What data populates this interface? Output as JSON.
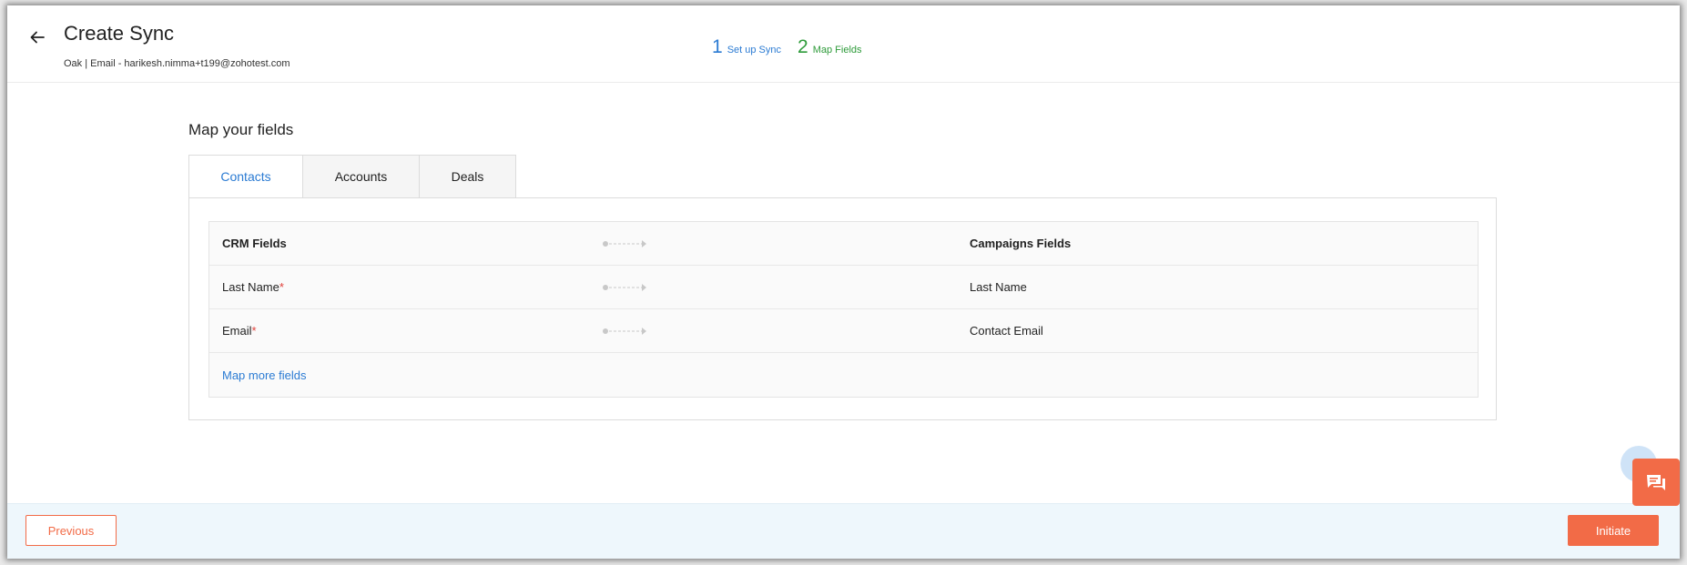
{
  "header": {
    "title": "Create Sync",
    "subtitle": "Oak | Email - harikesh.nimma+t199@zohotest.com",
    "steps": [
      {
        "number": "1",
        "label": "Set up Sync"
      },
      {
        "number": "2",
        "label": "Map Fields"
      }
    ]
  },
  "main": {
    "section_title": "Map your fields",
    "tabs": [
      {
        "label": "Contacts",
        "active": true
      },
      {
        "label": "Accounts",
        "active": false
      },
      {
        "label": "Deals",
        "active": false
      }
    ],
    "table": {
      "header_crm": "CRM Fields",
      "header_campaigns": "Campaigns Fields",
      "rows": [
        {
          "crm": "Last Name",
          "required": "*",
          "campaigns": "Last Name"
        },
        {
          "crm": "Email",
          "required": "*",
          "campaigns": "Contact Email"
        }
      ],
      "map_more_label": "Map more fields"
    }
  },
  "footer": {
    "previous_label": "Previous",
    "initiate_label": "Initiate"
  },
  "icons": {
    "back": "arrow-left-icon",
    "connector": "dashed-arrow-icon",
    "chat": "chat-icon"
  },
  "colors": {
    "accent_blue": "#2b7bd3",
    "step_green": "#2e9b3a",
    "primary_orange": "#f26b47",
    "required_red": "#e0403a",
    "footer_bg": "#eef7fc"
  }
}
